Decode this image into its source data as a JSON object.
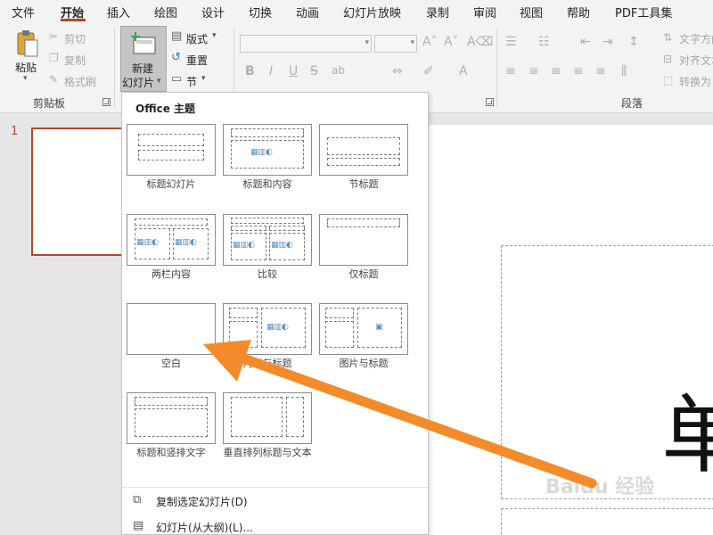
{
  "menu": {
    "items": [
      "文件",
      "开始",
      "插入",
      "绘图",
      "设计",
      "切换",
      "动画",
      "幻灯片放映",
      "录制",
      "审阅",
      "视图",
      "帮助",
      "PDF工具集"
    ]
  },
  "ribbon": {
    "clipboard": {
      "paste": "粘贴",
      "cut": "剪切",
      "copy": "复制",
      "format_painter": "格式刷",
      "group_label": "剪贴板"
    },
    "slides": {
      "new_slide_line1": "新建",
      "new_slide_line2": "幻灯片",
      "layout": "版式",
      "reset": "重置",
      "section": "节"
    },
    "font": {
      "bold": "B",
      "italic": "I",
      "underline": "U",
      "strike": "S",
      "shadow": "ab"
    },
    "paragraph": {
      "text_direction": "文字方向",
      "align_text": "对齐文本",
      "convert": "转换为",
      "group_label": "段落"
    }
  },
  "thumbnail": {
    "slide_number": "1"
  },
  "slide": {
    "big_char": "单",
    "watermark": "Baidu 经验"
  },
  "dropdown": {
    "title": "Office 主题",
    "layouts": [
      {
        "name": "标题幻灯片"
      },
      {
        "name": "标题和内容"
      },
      {
        "name": "节标题"
      },
      {
        "name": "两栏内容"
      },
      {
        "name": "比较"
      },
      {
        "name": "仅标题"
      },
      {
        "name": "空白"
      },
      {
        "name": "内容与标题"
      },
      {
        "name": "图片与标题"
      },
      {
        "name": "标题和竖排文字"
      },
      {
        "name": "垂直排列标题与文本"
      }
    ],
    "commands": [
      {
        "label": "复制选定幻灯片(D)"
      },
      {
        "label": "幻灯片(从大纲)(L)..."
      }
    ]
  },
  "colors": {
    "accent": "#b7472a",
    "arrow": "#f38b2a"
  }
}
